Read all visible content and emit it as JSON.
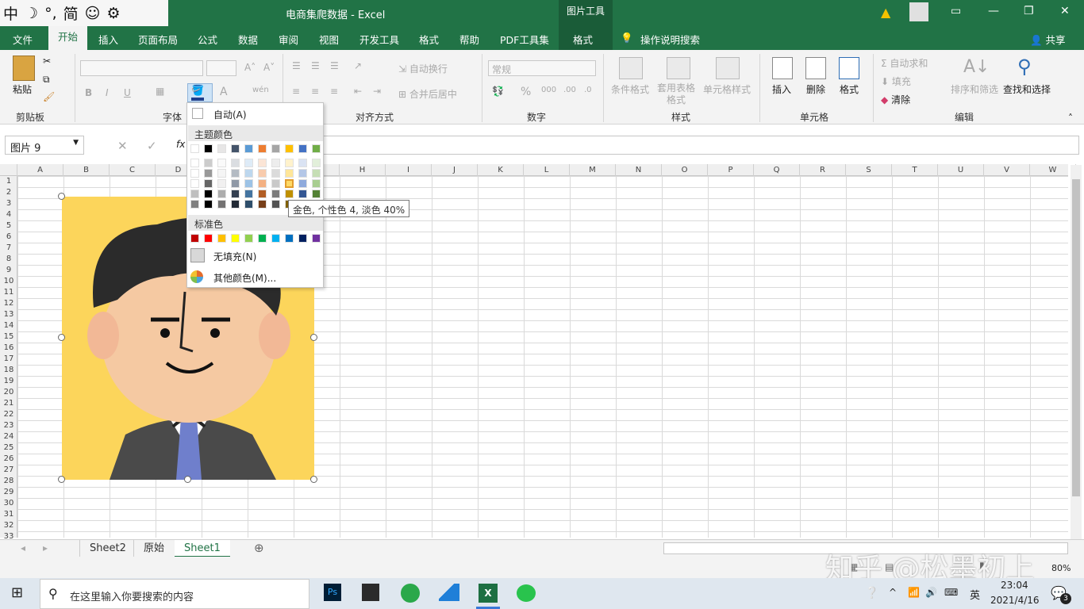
{
  "ime": {
    "chars": [
      "中",
      "☽",
      "°,",
      "简",
      "☺",
      "⚙"
    ]
  },
  "title": "电商集爬数据 - Excel",
  "picture_tools": "图片工具",
  "tabs": [
    "文件",
    "开始",
    "插入",
    "页面布局",
    "公式",
    "数据",
    "审阅",
    "视图",
    "开发工具",
    "格式",
    "帮助",
    "PDF工具集",
    "格式"
  ],
  "tell_me": "操作说明搜索",
  "share": "共享",
  "ribbon": {
    "clipboard": {
      "paste": "粘贴",
      "group": "剪贴板"
    },
    "font": {
      "group": "字体",
      "bold": "B",
      "italic": "I",
      "underline": "U"
    },
    "alignment": {
      "wrap": "自动换行",
      "merge": "合并后居中",
      "group": "对齐方式"
    },
    "number": {
      "format": "常规",
      "percent": "%",
      "group": "数字"
    },
    "styles": {
      "cond": "条件格式",
      "table": "套用表格格式",
      "cell": "单元格样式",
      "group": "样式"
    },
    "cells": {
      "insert": "插入",
      "delete": "删除",
      "format": "格式",
      "group": "单元格"
    },
    "editing": {
      "autosum": "自动求和",
      "fill": "填充",
      "clear": "清除",
      "sort": "排序和筛选",
      "find": "查找和选择",
      "group": "编辑"
    }
  },
  "namebox": "图片 9",
  "columns": [
    "A",
    "B",
    "C",
    "D",
    "E",
    "F",
    "G",
    "H",
    "I",
    "J",
    "K",
    "L",
    "M",
    "N",
    "O",
    "P",
    "Q",
    "R",
    "S",
    "T",
    "U",
    "V",
    "W"
  ],
  "rows": [
    "1",
    "2",
    "3",
    "4",
    "5",
    "6",
    "7",
    "8",
    "9",
    "10",
    "11",
    "12",
    "13",
    "14",
    "15",
    "16",
    "17",
    "18",
    "19",
    "20",
    "21",
    "22",
    "23",
    "24",
    "25",
    "26",
    "27",
    "28",
    "29",
    "30",
    "31",
    "32",
    "33"
  ],
  "color_popup": {
    "auto": "自动(A)",
    "theme_title": "主题颜色",
    "standard_title": "标准色",
    "no_fill": "无填充(N)",
    "more": "其他颜色(M)...",
    "theme_top": [
      "#ffffff",
      "#000000",
      "#e7e6e6",
      "#44546a",
      "#5b9bd5",
      "#ed7d31",
      "#a5a5a5",
      "#ffc000",
      "#4472c4",
      "#70ad47"
    ],
    "standard": [
      "#c00000",
      "#ff0000",
      "#ffc000",
      "#ffff00",
      "#92d050",
      "#00b050",
      "#00b0f0",
      "#0070c0",
      "#002060",
      "#7030a0"
    ]
  },
  "tooltip": "金色, 个性色 4, 淡色 40%",
  "sheets": [
    "Sheet2",
    "原始",
    "Sheet1"
  ],
  "status": {
    "zoom": "80%"
  },
  "taskbar": {
    "search": "在这里输入你要搜索的内容",
    "time": "23:04",
    "date": "2021/4/16",
    "lang": "英",
    "notif": "3"
  },
  "watermark": "知乎 @松墨初上"
}
